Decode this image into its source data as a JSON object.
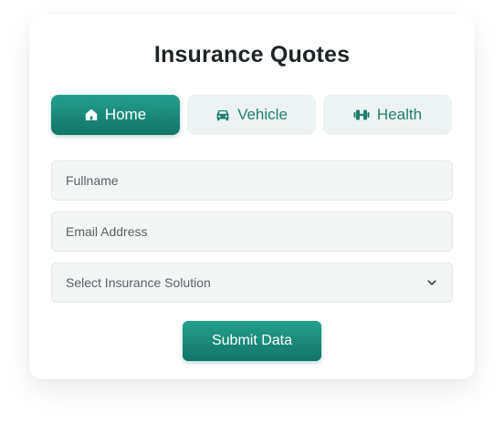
{
  "form": {
    "title": "Insurance Quotes",
    "tabs": [
      {
        "label": "Home",
        "icon": "home-icon",
        "active": true
      },
      {
        "label": "Vehicle",
        "icon": "car-icon",
        "active": false
      },
      {
        "label": "Health",
        "icon": "dumbbell-icon",
        "active": false
      }
    ],
    "fullname": {
      "placeholder": "Fullname",
      "value": ""
    },
    "email": {
      "placeholder": "Email Address",
      "value": ""
    },
    "solution": {
      "selected": "Select Insurance Solution",
      "icon": "chevron-down-icon"
    },
    "submit_label": "Submit Data"
  },
  "colors": {
    "accent": "#1a8c7b",
    "accent_dark": "#137566",
    "tab_inactive_bg": "#edf3f2",
    "field_bg": "#f4f6f6",
    "text": "#1e2326"
  }
}
